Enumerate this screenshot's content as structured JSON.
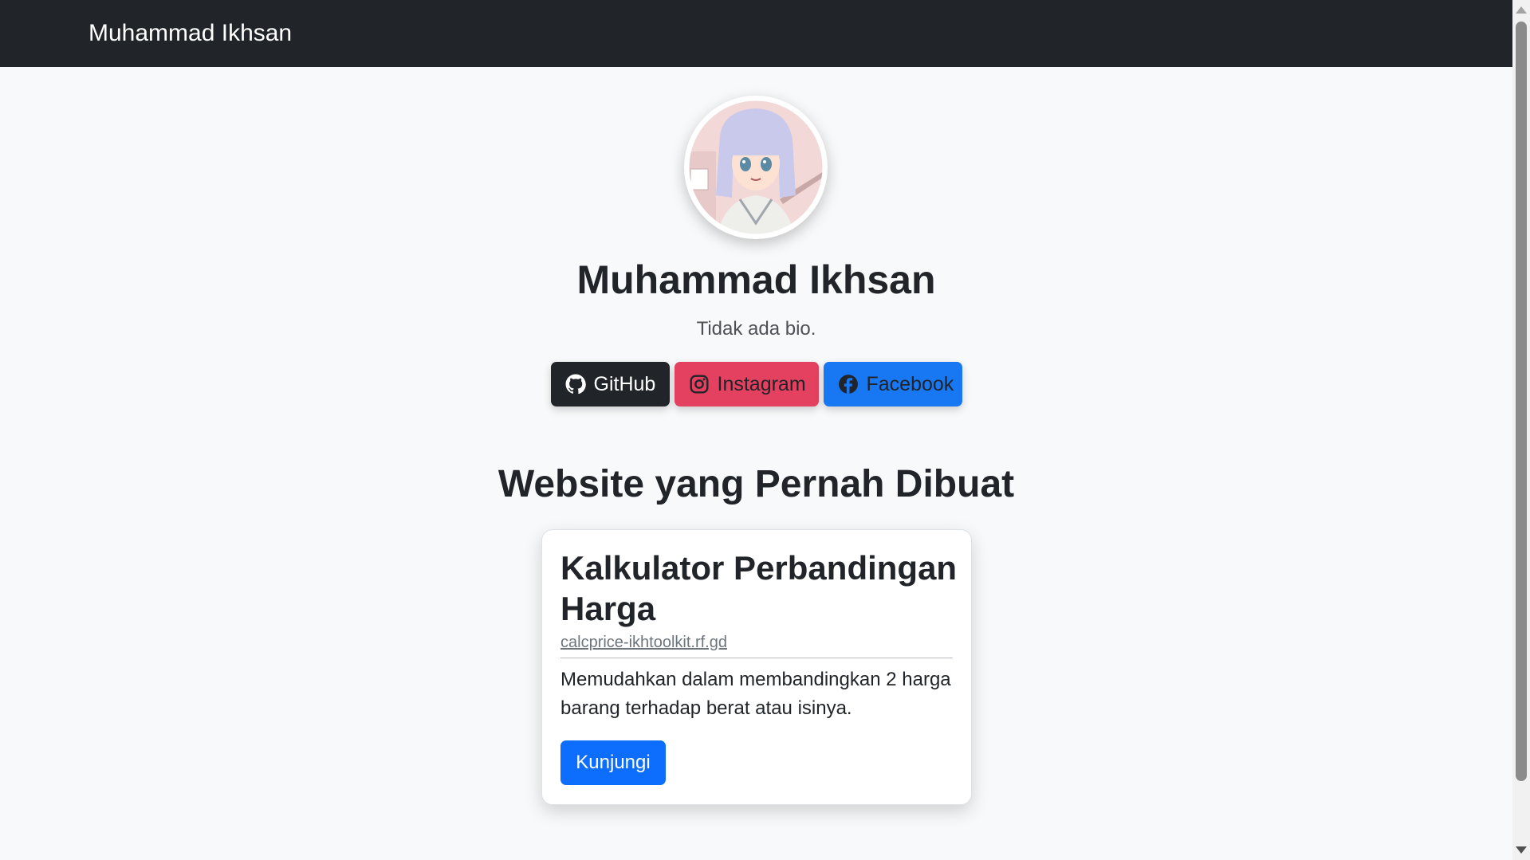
{
  "navbar": {
    "brand": "Muhammad Ikhsan"
  },
  "profile": {
    "name": "Muhammad Ikhsan",
    "bio": "Tidak ada bio."
  },
  "socials": [
    {
      "label": "GitHub",
      "icon": "github-icon",
      "color": "#212529"
    },
    {
      "label": "Instagram",
      "icon": "instagram-icon",
      "color": "#e4405f"
    },
    {
      "label": "Facebook",
      "icon": "facebook-icon",
      "color": "#1877f2"
    }
  ],
  "projects": {
    "heading": "Website yang Pernah Dibuat",
    "items": [
      {
        "title": "Kalkulator Perbandingan Harga",
        "url": "calcprice-ikhtoolkit.rf.gd",
        "description": "Memudahkan dalam membandingkan 2 harga barang terhadap berat atau isinya.",
        "button": "Kunjungi"
      }
    ]
  },
  "colors": {
    "navbar_bg": "#212529",
    "page_bg": "#f8f9fa",
    "primary": "#0d6efd"
  }
}
